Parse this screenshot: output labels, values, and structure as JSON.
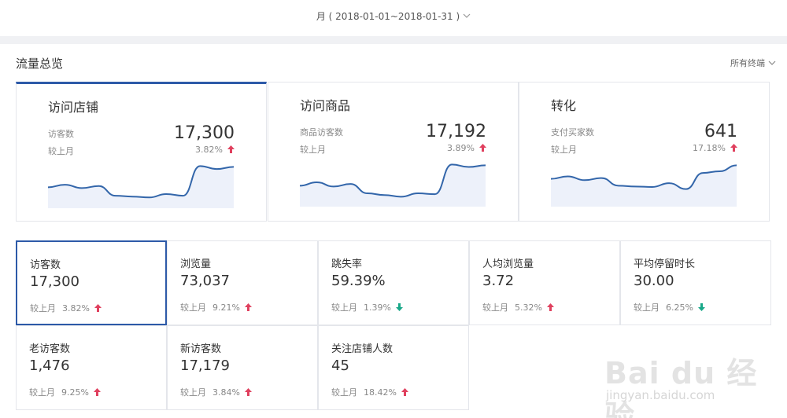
{
  "header": {
    "period_label": "月 ( 2018-01-01~2018-01-31 )"
  },
  "section": {
    "title": "流量总览",
    "terminal_filter": "所有终端"
  },
  "cards": [
    {
      "title": "访问店铺",
      "metric_label": "访客数",
      "value": "17,300",
      "compare_label": "较上月",
      "change": "3.82%",
      "trend": "up",
      "active": true,
      "sparkline": [
        0.42,
        0.48,
        0.4,
        0.45,
        0.22,
        0.2,
        0.18,
        0.26,
        0.22,
        0.92,
        0.85,
        0.9
      ]
    },
    {
      "title": "访问商品",
      "metric_label": "商品访客数",
      "value": "17,192",
      "compare_label": "较上月",
      "change": "3.89%",
      "trend": "up",
      "active": false,
      "sparkline": [
        0.42,
        0.5,
        0.4,
        0.46,
        0.24,
        0.2,
        0.16,
        0.24,
        0.22,
        0.92,
        0.86,
        0.9
      ]
    },
    {
      "title": "转化",
      "metric_label": "支付买家数",
      "value": "641",
      "compare_label": "较上月",
      "change": "17.18%",
      "trend": "up",
      "active": false,
      "sparkline": [
        0.58,
        0.64,
        0.55,
        0.6,
        0.42,
        0.4,
        0.39,
        0.48,
        0.34,
        0.72,
        0.76,
        0.9
      ]
    }
  ],
  "metrics": [
    {
      "label": "访客数",
      "value": "17,300",
      "compare_label": "较上月",
      "change": "3.82%",
      "trend": "up",
      "selected": true
    },
    {
      "label": "浏览量",
      "value": "73,037",
      "compare_label": "较上月",
      "change": "9.21%",
      "trend": "up",
      "selected": false
    },
    {
      "label": "跳失率",
      "value": "59.39%",
      "compare_label": "较上月",
      "change": "1.39%",
      "trend": "down",
      "selected": false
    },
    {
      "label": "人均浏览量",
      "value": "3.72",
      "compare_label": "较上月",
      "change": "5.32%",
      "trend": "up",
      "selected": false
    },
    {
      "label": "平均停留时长",
      "value": "30.00",
      "compare_label": "较上月",
      "change": "6.25%",
      "trend": "down",
      "selected": false
    },
    {
      "label": "老访客数",
      "value": "1,476",
      "compare_label": "较上月",
      "change": "9.25%",
      "trend": "up",
      "selected": false
    },
    {
      "label": "新访客数",
      "value": "17,179",
      "compare_label": "较上月",
      "change": "3.84%",
      "trend": "up",
      "selected": false
    },
    {
      "label": "关注店铺人数",
      "value": "45",
      "compare_label": "较上月",
      "change": "18.42%",
      "trend": "up",
      "selected": false
    }
  ],
  "colors": {
    "accent": "#2d5aa8",
    "line": "#3366aa",
    "area": "#edf1fa",
    "up": "#e0405e",
    "down": "#19a889"
  },
  "icons": {
    "chevron": "chevron-down-icon",
    "up": "arrow-up-icon",
    "down": "arrow-down-icon"
  },
  "watermark": {
    "brand": "Bai du 经验",
    "url": "jingyan.baidu.com"
  }
}
